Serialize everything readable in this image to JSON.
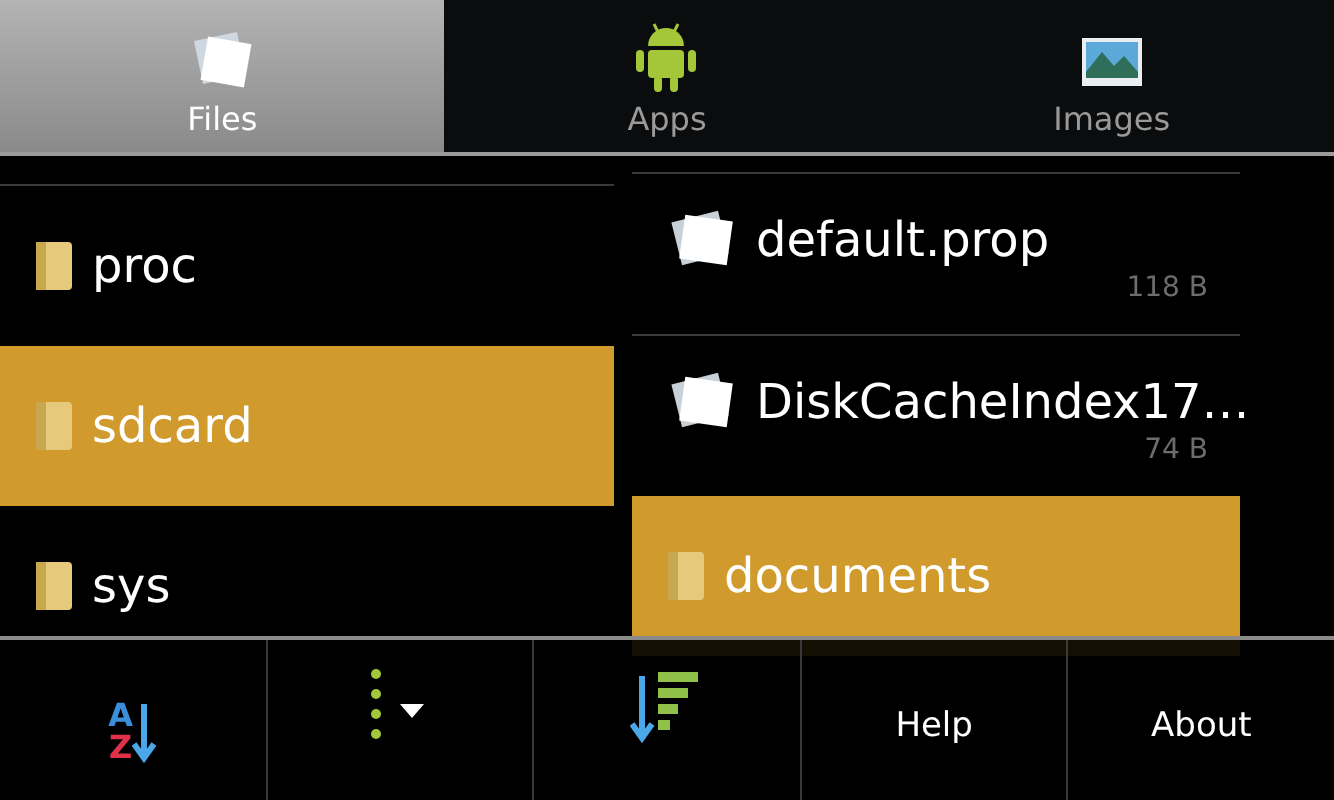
{
  "tabs": [
    {
      "label": "Files",
      "kind": "files",
      "selected": true
    },
    {
      "label": "Apps",
      "kind": "apps",
      "selected": false
    },
    {
      "label": "Images",
      "kind": "images",
      "selected": false
    }
  ],
  "left_pane": {
    "items": [
      {
        "name": "proc",
        "kind": "folder",
        "selected": false
      },
      {
        "name": "sdcard",
        "kind": "folder",
        "selected": true
      },
      {
        "name": "sys",
        "kind": "folder",
        "selected": false
      }
    ]
  },
  "right_pane": {
    "items": [
      {
        "name": "default.prop",
        "size": "118 B",
        "kind": "file",
        "selected": false
      },
      {
        "name": "DiskCacheIndex17…",
        "size": "74 B",
        "kind": "file",
        "selected": false
      },
      {
        "name": "documents",
        "kind": "folder",
        "selected": true
      }
    ]
  },
  "menu": [
    {
      "kind": "sort-name",
      "letters": [
        "A",
        "Z"
      ]
    },
    {
      "kind": "sort-type"
    },
    {
      "kind": "sort-size"
    },
    {
      "kind": "text",
      "label": "Help"
    },
    {
      "kind": "text",
      "label": "About"
    }
  ]
}
